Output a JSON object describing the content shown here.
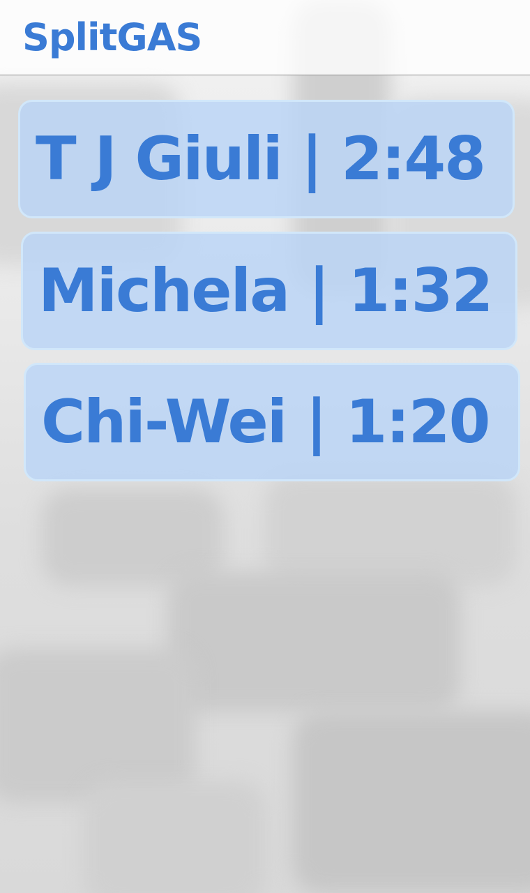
{
  "app": {
    "title": "SplitGAS"
  },
  "entries": [
    {
      "text": "T J Giuli | 2:48"
    },
    {
      "text": "Michela | 1:32"
    },
    {
      "text": "Chi-Wei | 1:20"
    }
  ],
  "colors": {
    "accent": "#3a7bd5",
    "card_fill": "#b9d4f6",
    "divider": "#8a8a8a"
  }
}
